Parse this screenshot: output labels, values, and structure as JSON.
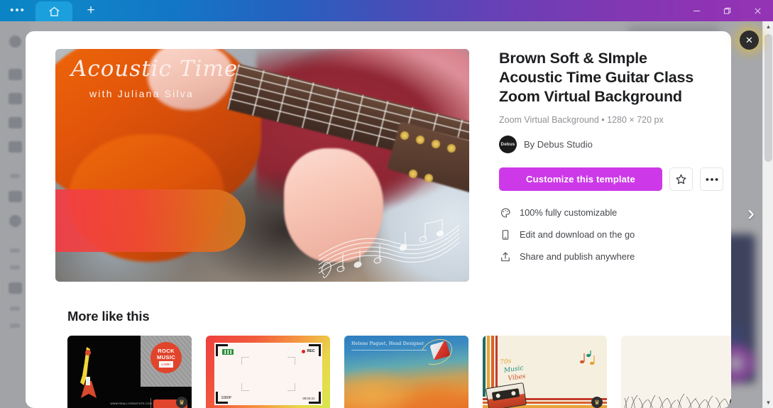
{
  "window": {
    "tabs": [
      {
        "name": "overflow-menu",
        "label": "•••"
      },
      {
        "name": "home-tab",
        "label": ""
      },
      {
        "name": "new-tab",
        "label": "+"
      }
    ],
    "controls": {
      "minimize": "–",
      "maximize": "❐",
      "close": "✕"
    }
  },
  "modal": {
    "close_label": "✕",
    "next_label": "›",
    "preview": {
      "banner_title": "Acoustic Time",
      "banner_subtitle": "with Juliana Silva"
    },
    "title": "Brown Soft & SImple Acoustic Time Guitar Class Zoom Virtual Background",
    "meta": "Zoom Virtual Background • 1280 × 720 px",
    "avatar_text": "Debus",
    "author": "By Debus Studio",
    "primary_button": "Customize this template",
    "favorite_button_icon": "star-icon",
    "more_button_icon": "ellipsis-icon",
    "features": [
      {
        "icon": "palette-icon",
        "text": "100% fully customizable"
      },
      {
        "icon": "mobile-device-icon",
        "text": "Edit and download on the go"
      },
      {
        "icon": "share-upload-icon",
        "text": "Share and publish anywhere"
      }
    ],
    "more_like_this_heading": "More like this",
    "thumbnails": [
      {
        "name": "rock-music-live-template",
        "badge": "crown-icon",
        "texts": {
          "line1": "ROCK",
          "line2": "MUSIC",
          "line3": "LIVE!",
          "footer": "WWW.REALLYGREATSITE.COM"
        }
      },
      {
        "name": "camera-viewfinder-template",
        "texts": {
          "rec": "REC",
          "quality": "1080P",
          "timecode": "00:04:21"
        }
      },
      {
        "name": "designer-gradient-template",
        "texts": {
          "name": "Helene Paquet, Head Designer"
        }
      },
      {
        "name": "retro-70s-music-vibes-template",
        "badge": "crown-icon",
        "texts": {
          "line1": "70s",
          "line2": "Music",
          "line3": "Vibes"
        }
      },
      {
        "name": "cream-grass-template",
        "badge": "crown-icon",
        "texts": {}
      }
    ]
  },
  "colors": {
    "accent": "#cd39e8",
    "titlebar_start": "#0a84c4",
    "titlebar_end": "#9434b5",
    "active_tab": "#1ba0dd",
    "banner_start": "#f33c46",
    "banner_end": "#d8781c",
    "text_primary": "#1d1e20",
    "text_muted": "#8e9196"
  }
}
